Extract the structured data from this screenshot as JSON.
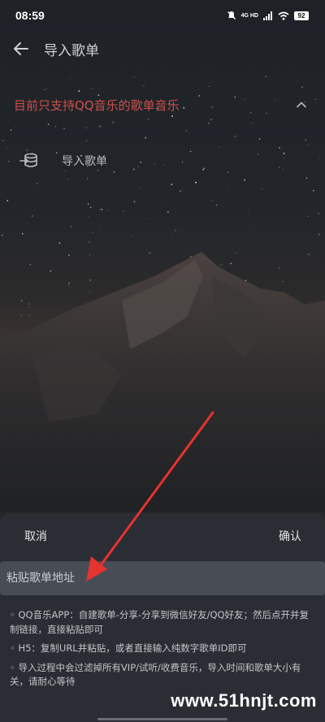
{
  "status_bar": {
    "time": "08:59",
    "network": "4G HD",
    "battery": "92"
  },
  "app_bar": {
    "title": "导入歌单",
    "back_icon": "arrow-left-icon"
  },
  "notice": {
    "text": "目前只支持QQ音乐的歌单音乐",
    "color": "#cf4f4a"
  },
  "import_row": {
    "icon": "playlist-import-icon",
    "label": "导入歌单"
  },
  "sheet": {
    "cancel_label": "取消",
    "confirm_label": "确认",
    "input_placeholder": "粘贴歌单地址",
    "input_value": "",
    "tips": [
      "◦ QQ音乐APP：自建歌单-分享-分享到微信好友/QQ好友；然后点开并复制链接，直接粘贴即可",
      "◦ H5：复制URL并粘贴，或者直接输入纯数字歌单ID即可",
      "◦ 导入过程中会过滤掉所有VIP/试听/收费音乐，导入时间和歌单大小有关，请耐心等待"
    ]
  },
  "watermark": "www.51hnjt.com",
  "colors": {
    "annotation_arrow": "#e5332f"
  }
}
